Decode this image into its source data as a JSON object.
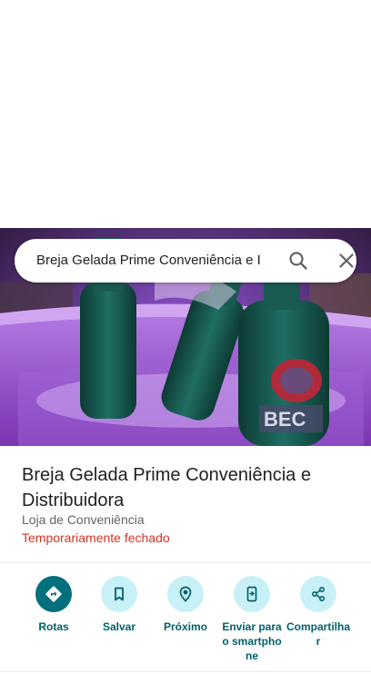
{
  "search": {
    "query": "Breja Gelada Prime Conveniência e I"
  },
  "place": {
    "name": "Breja Gelada Prime Conveniência e Distribuidora",
    "category": "Loja de Conveniência",
    "status": "Temporariamente fechado"
  },
  "hero": {
    "bottle_label": "BEC"
  },
  "actions": [
    {
      "label": "Rotas",
      "icon": "directions-icon"
    },
    {
      "label": "Salvar",
      "icon": "bookmark-icon"
    },
    {
      "label": "Próximo",
      "icon": "nearby-icon"
    },
    {
      "label": "Enviar para o smartphone",
      "icon": "send-to-phone-icon"
    },
    {
      "label": "Compartilhar",
      "icon": "share-icon"
    }
  ],
  "colors": {
    "primary_teal": "#00707c",
    "action_bg": "#c8f1f7",
    "status_red": "#d93025"
  }
}
